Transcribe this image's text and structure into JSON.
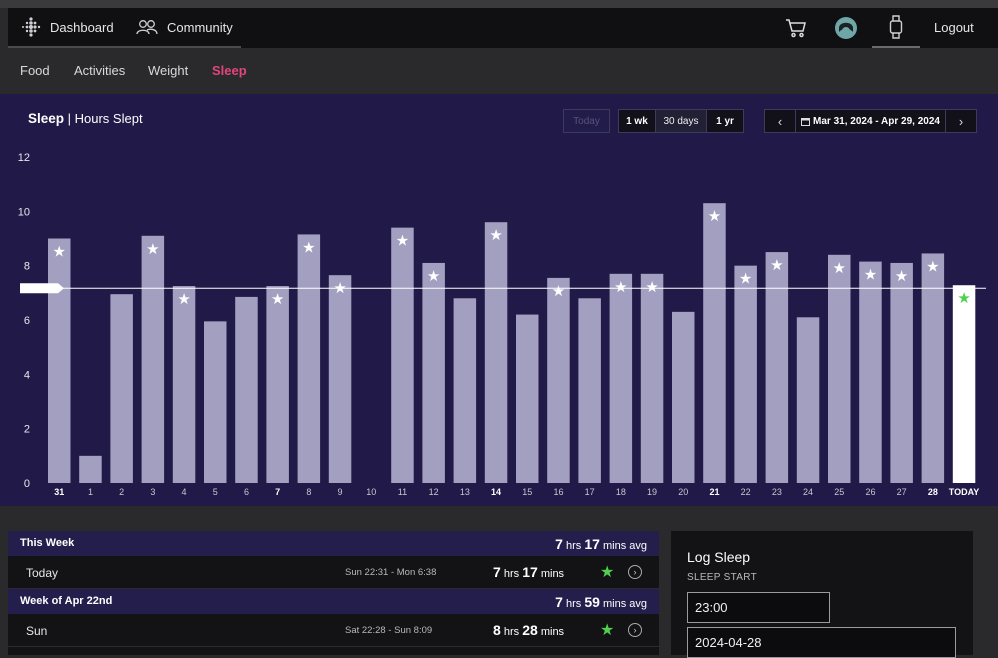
{
  "topbar": {
    "dashboard": "Dashboard",
    "community": "Community",
    "logout": "Logout",
    "icons": [
      "fitbit-dots-icon",
      "community-icon",
      "cart-icon",
      "face-icon",
      "watch-icon"
    ]
  },
  "subnav": {
    "tabs": [
      {
        "label": "Food",
        "active": false
      },
      {
        "label": "Activities",
        "active": false
      },
      {
        "label": "Weight",
        "active": false
      },
      {
        "label": "Sleep",
        "active": true
      }
    ]
  },
  "controls": {
    "title_bold": "Sleep",
    "title_rest": " | Hours Slept",
    "today": "Today",
    "ranges": [
      "1 wk",
      "30 days",
      "1 yr"
    ],
    "selected_range": "30 days",
    "date_range": "Mar 31, 2024 - Apr 29, 2024",
    "prev": "‹",
    "next": "›"
  },
  "colors": {
    "panel": "#211a48",
    "bar": "#a39fc0",
    "today_bar": "#ffffff",
    "accent": "#e0457b",
    "goal_star": "#4fd04f"
  },
  "chart_data": {
    "type": "bar",
    "ylim": [
      0,
      12
    ],
    "yticks": [
      0,
      2,
      4,
      6,
      8,
      10,
      12
    ],
    "goal": 7.17,
    "categories": [
      "31",
      "1",
      "2",
      "3",
      "4",
      "5",
      "6",
      "7",
      "8",
      "9",
      "10",
      "11",
      "12",
      "13",
      "14",
      "15",
      "16",
      "17",
      "18",
      "19",
      "20",
      "21",
      "22",
      "23",
      "24",
      "25",
      "26",
      "27",
      "28",
      "TODAY"
    ],
    "bold_categories": [
      "31",
      "7",
      "14",
      "21",
      "28",
      "TODAY"
    ],
    "values": [
      9.0,
      1.0,
      6.95,
      9.1,
      7.25,
      5.95,
      6.85,
      7.25,
      9.15,
      7.65,
      0,
      9.4,
      8.1,
      6.8,
      9.6,
      6.2,
      7.55,
      6.8,
      7.7,
      7.7,
      6.3,
      10.3,
      8.0,
      8.5,
      6.1,
      8.4,
      8.15,
      8.1,
      8.45,
      7.28
    ],
    "stars": [
      true,
      false,
      false,
      true,
      true,
      false,
      false,
      true,
      true,
      true,
      false,
      true,
      true,
      false,
      true,
      false,
      true,
      false,
      true,
      true,
      false,
      true,
      true,
      true,
      false,
      true,
      true,
      true,
      true,
      true
    ]
  },
  "weeks": [
    {
      "label": "This Week",
      "avg_hrs": "7",
      "avg_mins": "17",
      "rows": [
        {
          "day": "Today",
          "range": "Sun 22:31 - Mon 6:38",
          "hrs": "7",
          "mins": "17"
        }
      ]
    },
    {
      "label": "Week of Apr 22nd",
      "avg_hrs": "7",
      "avg_mins": "59",
      "rows": [
        {
          "day": "Sun",
          "range": "Sat 22:28 - Sun 8:09",
          "hrs": "8",
          "mins": "28"
        }
      ]
    }
  ],
  "units": {
    "hrs": " hrs ",
    "mins": " mins",
    "avg": " mins avg"
  },
  "log": {
    "title": "Log Sleep",
    "start_label": "SLEEP START",
    "start_time": "23:00",
    "start_date": "2024-04-28"
  }
}
